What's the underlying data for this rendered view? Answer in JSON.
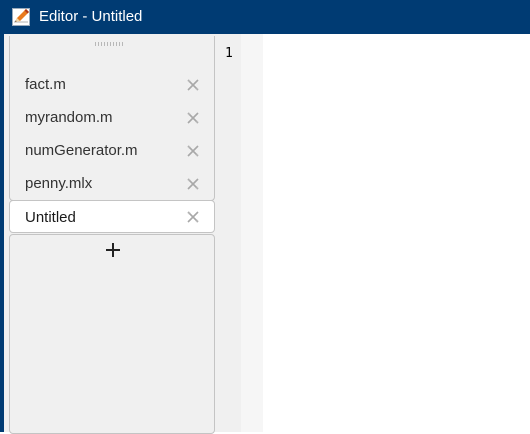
{
  "window": {
    "title": "Editor - Untitled",
    "title_icon": "editor-pencil-icon",
    "title_bar_color": "#003b73"
  },
  "tabs": [
    {
      "label": "fact.m",
      "active": false,
      "close_icon": "close-icon"
    },
    {
      "label": "myrandom.m",
      "active": false,
      "close_icon": "close-icon"
    },
    {
      "label": "numGenerator.m",
      "active": false,
      "close_icon": "close-icon"
    },
    {
      "label": "penny.mlx",
      "active": false,
      "close_icon": "close-icon"
    },
    {
      "label": "Untitled",
      "active": true,
      "close_icon": "close-icon"
    }
  ],
  "add_tab_icon": "plus-icon",
  "editor": {
    "line_numbers": [
      "1"
    ],
    "content": ""
  }
}
